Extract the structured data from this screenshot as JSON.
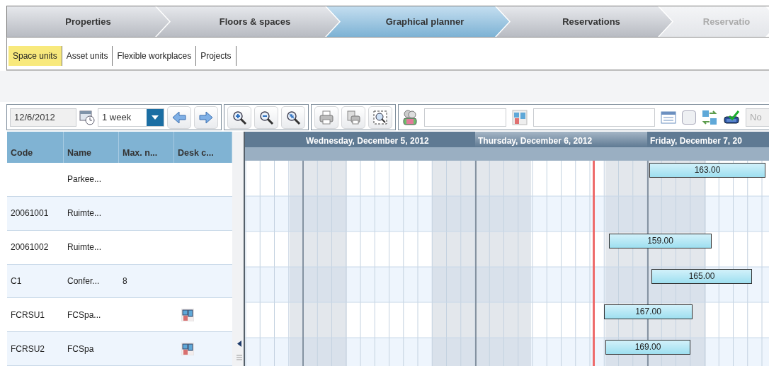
{
  "wizard_steps": [
    {
      "label": "Properties",
      "selected": false,
      "disabled": false
    },
    {
      "label": "Floors & spaces",
      "selected": false,
      "disabled": false
    },
    {
      "label": "Graphical planner",
      "selected": true,
      "disabled": false
    },
    {
      "label": "Reservations",
      "selected": false,
      "disabled": false
    },
    {
      "label": "Reservatio",
      "selected": false,
      "disabled": true
    }
  ],
  "subtabs": [
    {
      "label": "Space units",
      "selected": true
    },
    {
      "label": "Asset units",
      "selected": false
    },
    {
      "label": "Flexible workplaces",
      "selected": false
    },
    {
      "label": "Projects",
      "selected": false
    }
  ],
  "toolbar": {
    "date": "12/6/2012",
    "period": "1 week",
    "show_all": {
      "checked": false
    },
    "availability": "No"
  },
  "grid": {
    "columns": [
      "Code",
      "Name",
      "Max. n...",
      "Desk c..."
    ],
    "rows": [
      {
        "name": "Parkee...",
        "desk": false,
        "booking": "163.00"
      },
      {
        "code": "20061001",
        "name": "Ruimte...",
        "desk": false
      },
      {
        "code": "20061002",
        "name": "Ruimte...",
        "desk": false,
        "booking": "159.00"
      },
      {
        "code": "C1",
        "name": "Confer...",
        "max": "8",
        "desk": false,
        "booking": "165.00"
      },
      {
        "code": "FCRSU1",
        "name": "FCSpa...",
        "desk": true,
        "booking": "167.00"
      },
      {
        "code": "FCRSU2",
        "name": "FCSpa",
        "desk": true,
        "booking": "169.00"
      }
    ]
  },
  "timeline": {
    "days": [
      {
        "label": "Wednesday, December 5, 2012",
        "selected": false
      },
      {
        "label": "Thursday, December 6, 2012",
        "selected": true
      },
      {
        "label": "Friday, December 7, 20",
        "selected": false
      }
    ]
  }
}
